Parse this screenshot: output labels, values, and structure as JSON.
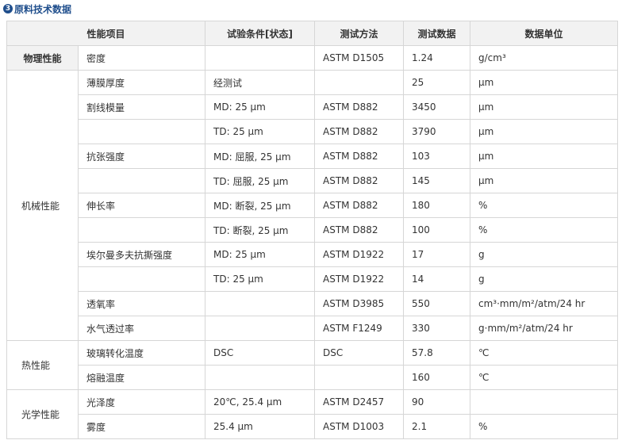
{
  "title": {
    "number": "3",
    "text": "原料技术数据"
  },
  "table": {
    "headers": [
      "性能项目",
      "试验条件[状态]",
      "测试方法",
      "测试数据",
      "数据单位"
    ],
    "categories": {
      "physical": "物理性能",
      "mechanical": "机械性能",
      "thermal": "热性能",
      "optical": "光学性能"
    },
    "rows": [
      {
        "item": "密度",
        "condition": "",
        "method": "ASTM D1505",
        "value": "1.24",
        "unit": "g/cm³"
      },
      {
        "item": "薄膜厚度",
        "condition": "经测试",
        "method": "",
        "value": "25",
        "unit": "μm"
      },
      {
        "item": "割线模量",
        "condition": "MD: 25 μm",
        "method": "ASTM D882",
        "value": "3450",
        "unit": "μm"
      },
      {
        "item": "",
        "condition": "TD: 25 μm",
        "method": "ASTM D882",
        "value": "3790",
        "unit": "μm"
      },
      {
        "item": "抗张强度",
        "condition": "MD: 屈服, 25 μm",
        "method": "ASTM D882",
        "value": "103",
        "unit": "μm"
      },
      {
        "item": "",
        "condition": "TD: 屈服, 25 μm",
        "method": "ASTM D882",
        "value": "145",
        "unit": "μm"
      },
      {
        "item": "伸长率",
        "condition": "MD: 断裂, 25 μm",
        "method": "ASTM D882",
        "value": "180",
        "unit": "%"
      },
      {
        "item": "",
        "condition": "TD: 断裂, 25 μm",
        "method": "ASTM D882",
        "value": "100",
        "unit": "%"
      },
      {
        "item": "埃尔曼多夫抗撕强度",
        "condition": "MD: 25 μm",
        "method": "ASTM D1922",
        "value": "17",
        "unit": "g"
      },
      {
        "item": "",
        "condition": "TD: 25 μm",
        "method": "ASTM D1922",
        "value": "14",
        "unit": "g"
      },
      {
        "item": "透氧率",
        "condition": "",
        "method": "ASTM D3985",
        "value": "550",
        "unit": "cm³·mm/m²/atm/24 hr"
      },
      {
        "item": "水气透过率",
        "condition": "",
        "method": "ASTM F1249",
        "value": "330",
        "unit": "g·mm/m²/atm/24 hr"
      },
      {
        "item": "玻璃转化温度",
        "condition": "DSC",
        "method": "DSC",
        "value": "57.8",
        "unit": "℃"
      },
      {
        "item": "熔融温度",
        "condition": "",
        "method": "",
        "value": "160",
        "unit": "℃"
      },
      {
        "item": "光泽度",
        "condition": "20℃, 25.4 μm",
        "method": "ASTM D2457",
        "value": "90",
        "unit": ""
      },
      {
        "item": "雾度",
        "condition": "25.4 μm",
        "method": "ASTM D1003",
        "value": "2.1",
        "unit": "%"
      }
    ]
  }
}
